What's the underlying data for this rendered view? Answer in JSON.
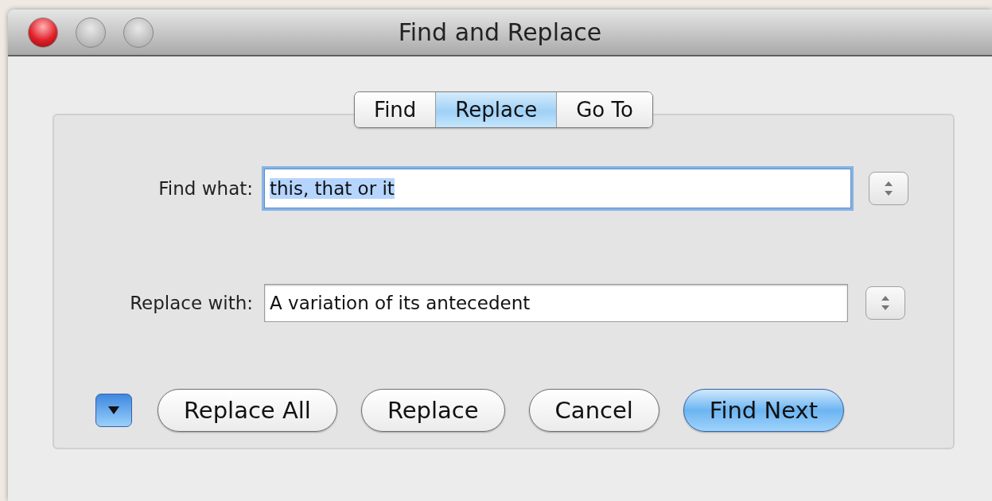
{
  "window": {
    "title": "Find and Replace"
  },
  "tabs": [
    {
      "label": "Find",
      "selected": false
    },
    {
      "label": "Replace",
      "selected": true
    },
    {
      "label": "Go To",
      "selected": false
    }
  ],
  "fields": [
    {
      "label": "Find what:",
      "value": "this, that or it",
      "focused": true,
      "text_selected": true
    },
    {
      "label": "Replace with:",
      "value": "A variation of its antecedent",
      "focused": false,
      "text_selected": false
    }
  ],
  "buttons": [
    {
      "label": "Replace All",
      "default": false
    },
    {
      "label": "Replace",
      "default": false
    },
    {
      "label": "Cancel",
      "default": false
    },
    {
      "label": "Find Next",
      "default": true
    }
  ]
}
